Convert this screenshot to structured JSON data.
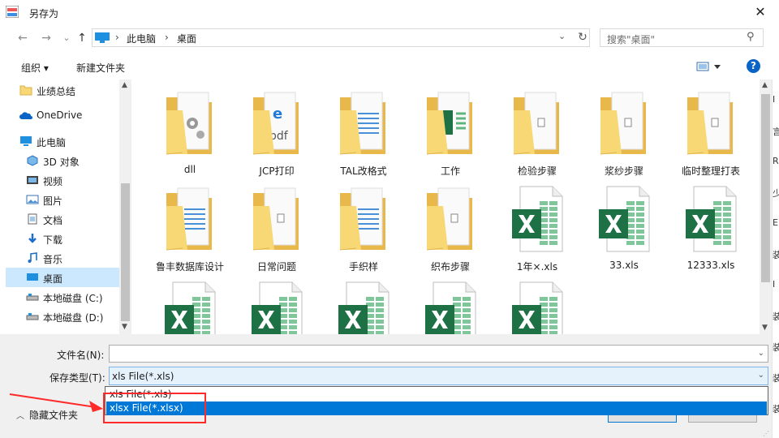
{
  "window": {
    "title": "另存为",
    "close_glyph": "✕"
  },
  "nav": {
    "back": "←",
    "forward": "→",
    "recent": "⌄",
    "up": "↑",
    "breadcrumb": [
      "此电脑",
      "桌面"
    ],
    "crumb_separator": "›",
    "search_placeholder": "搜索\"桌面\""
  },
  "toolbar": {
    "organize": "组织 ▾",
    "new_folder": "新建文件夹",
    "help": "?"
  },
  "sidebar": {
    "items": [
      {
        "label": "业绩总结",
        "icon": "folder-icon"
      },
      {
        "label": "OneDrive",
        "icon": "cloud-icon"
      },
      {
        "label": "此电脑",
        "icon": "computer-icon"
      },
      {
        "label": "3D 对象",
        "icon": "cube-icon"
      },
      {
        "label": "视频",
        "icon": "video-icon"
      },
      {
        "label": "图片",
        "icon": "picture-icon"
      },
      {
        "label": "文档",
        "icon": "document-icon"
      },
      {
        "label": "下载",
        "icon": "download-icon"
      },
      {
        "label": "音乐",
        "icon": "music-icon"
      },
      {
        "label": "桌面",
        "icon": "desktop-icon",
        "selected": true
      },
      {
        "label": "本地磁盘 (C:)",
        "icon": "drive-icon"
      },
      {
        "label": "本地磁盘 (D:)",
        "icon": "drive-icon"
      }
    ]
  },
  "files": [
    {
      "name": "dll",
      "type": "folder-gear"
    },
    {
      "name": "JCP打印",
      "type": "folder-pdf"
    },
    {
      "name": "TAL改格式",
      "type": "folder-doc"
    },
    {
      "name": "工作",
      "type": "folder-sheet"
    },
    {
      "name": "检验步骤",
      "type": "folder-file"
    },
    {
      "name": "浆纱步骤",
      "type": "folder-file"
    },
    {
      "name": "临时整理打表",
      "type": "folder-file"
    },
    {
      "name": "鲁丰数据库设计",
      "type": "folder-doc"
    },
    {
      "name": "日常问题",
      "type": "folder-file"
    },
    {
      "name": "手织样",
      "type": "folder-doc"
    },
    {
      "name": "织布步骤",
      "type": "folder-file"
    },
    {
      "name": "1年×.xls",
      "type": "excel"
    },
    {
      "name": "33.xls",
      "type": "excel"
    },
    {
      "name": "12333.xls",
      "type": "excel"
    },
    {
      "name": "",
      "type": "excel"
    },
    {
      "name": "",
      "type": "excel"
    },
    {
      "name": "",
      "type": "excel"
    },
    {
      "name": "",
      "type": "excel"
    },
    {
      "name": "",
      "type": "excel"
    }
  ],
  "form": {
    "filename_label": "文件名(N):",
    "filename_value": "",
    "savetype_label": "保存类型(T):",
    "savetype_value": "xls File(*.xls)",
    "options": [
      "xls File(*.xls)",
      "xlsx File(*.xlsx)"
    ],
    "selected_option_index": 1,
    "hide_folders": "隐藏文件夹"
  },
  "right_sliver_chars": [
    "I",
    "言",
    "R",
    "少",
    "E",
    "装",
    "I",
    "装",
    "装",
    "装",
    "装"
  ],
  "colors": {
    "selection": "#0078d7",
    "nav_selected": "#cce8ff",
    "annotation": "#ff2a2a",
    "folder": "#f8d775",
    "excel_green": "#1e7145"
  }
}
